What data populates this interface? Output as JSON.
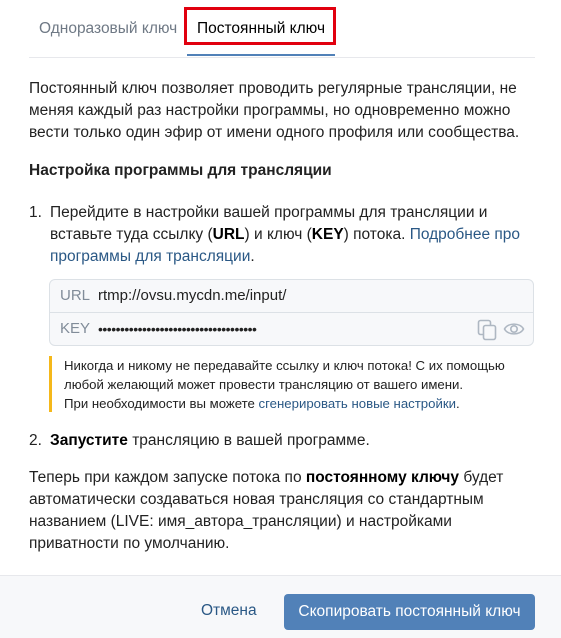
{
  "tabs": [
    {
      "label": "Одноразовый ключ"
    },
    {
      "label": "Постоянный ключ"
    }
  ],
  "intro": "Постоянный ключ позволяет проводить регулярные трансляции, не меняя каждый раз настройки программы, но одновременно можно вести только один эфир от имени одного профиля или сообщества.",
  "section_title": "Настройка программы для трансляции",
  "step1": {
    "number": "1.",
    "text_before": "Перейдите в настройки вашей программы для трансляции и вставьте туда ссылку (",
    "url_word": "URL",
    "text_mid": ") и ключ (",
    "key_word": "KEY",
    "text_after": ") потока. ",
    "link": "Подробнее про программы для трансляции",
    "end": "."
  },
  "stream_fields": {
    "url_label": "URL",
    "url_value": "rtmp://ovsu.mycdn.me/input/",
    "key_label": "KEY",
    "key_value": "••••••••••••••••••••••••••••••••••••",
    "copy_icon": "copy-icon",
    "eye_icon": "eye-icon"
  },
  "warning": {
    "text": "Никогда и никому не передавайте ссылку и ключ потока! С их помощью любой желающий может провести трансляцию от вашего имени.",
    "text2": "При необходимости вы можете ",
    "link": "сгенерировать новые настройки",
    "end": ".",
    "accent": "#f5b81a"
  },
  "step2": {
    "number": "2.",
    "bold": "Запустите",
    "text": " трансляцию в вашей программе."
  },
  "outro": {
    "before": "Теперь при каждом запуске потока по ",
    "bold": "постоянному ключу",
    "after": " будет автоматически создаваться новая трансляция со стандартным названием (LIVE: имя_автора_трансляции) и настройками приватности по умолчанию."
  },
  "footer": {
    "cancel": "Отмена",
    "primary": "Скопировать постоянный ключ"
  },
  "colors": {
    "accent": "#5181b8",
    "link": "#2a5885",
    "highlight": "#e1000f"
  }
}
